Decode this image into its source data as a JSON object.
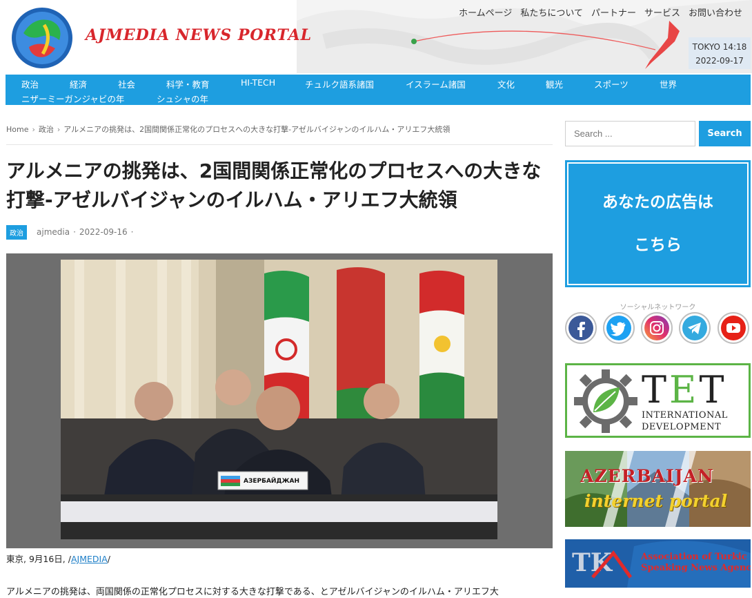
{
  "header": {
    "logo_text": "AJMEDIA NEWS PORTAL",
    "top_nav": [
      "ホームページ",
      "私たちについて",
      "パートナー",
      "サービス",
      "お問い合わせ"
    ],
    "clock_city_time": "TOKYO 14:18",
    "clock_date": "2022-09-17"
  },
  "main_nav": [
    "政治",
    "経済",
    "社会",
    "科学・教育",
    "HI-TECH",
    "チュルク語系諸国",
    "イスラーム諸国",
    "文化",
    "観光",
    "スポーツ",
    "世界",
    "ニザーミーガンジャビの年",
    "シュシャの年"
  ],
  "breadcrumb": {
    "home": "Home",
    "category": "政治",
    "current": "アルメニアの挑発は、2国間関係正常化のプロセスへの大きな打撃-アゼルバイジャンのイルハム・アリエフ大統領"
  },
  "article": {
    "title": "アルメニアの挑発は、2国間関係正常化のプロセスへの大きな打撃-アゼルバイジャンのイルハム・アリエフ大統領",
    "category_badge": "政治",
    "author": "ajmedia",
    "date": "2022-09-16",
    "nameplate": "АЗЕРБАЙДЖАН",
    "caption_prefix": "東京, 9月16日, /",
    "caption_link": "AJMEDIA",
    "caption_suffix": "/",
    "first_paragraph": "アルメニアの挑発は、両国関係の正常化プロセスに対する大きな打撃である、とアゼルバイジャンのイルハム・アリエフ大"
  },
  "sidebar": {
    "search_placeholder": "Search ...",
    "search_button": "Search",
    "ad_line1": "あなたの広告は",
    "ad_line2": "こちら",
    "social_title": "ソーシャルネットワーク",
    "tet_logo": "TET",
    "tet_sub1": "INTERNATIONAL",
    "tet_sub2": "DEVELOPMENT",
    "aze_title": "AZERBAIJAN",
    "aze_sub": "internet portal",
    "tk_logo": "TK",
    "tk_line1": "Association of Turkic",
    "tk_line2": "Speaking News Agencies"
  },
  "colors": {
    "accent": "#1e9ee0",
    "logo_red": "#d8262c",
    "tet_green": "#5cb446",
    "tk_blue": "#1f5fa8"
  }
}
